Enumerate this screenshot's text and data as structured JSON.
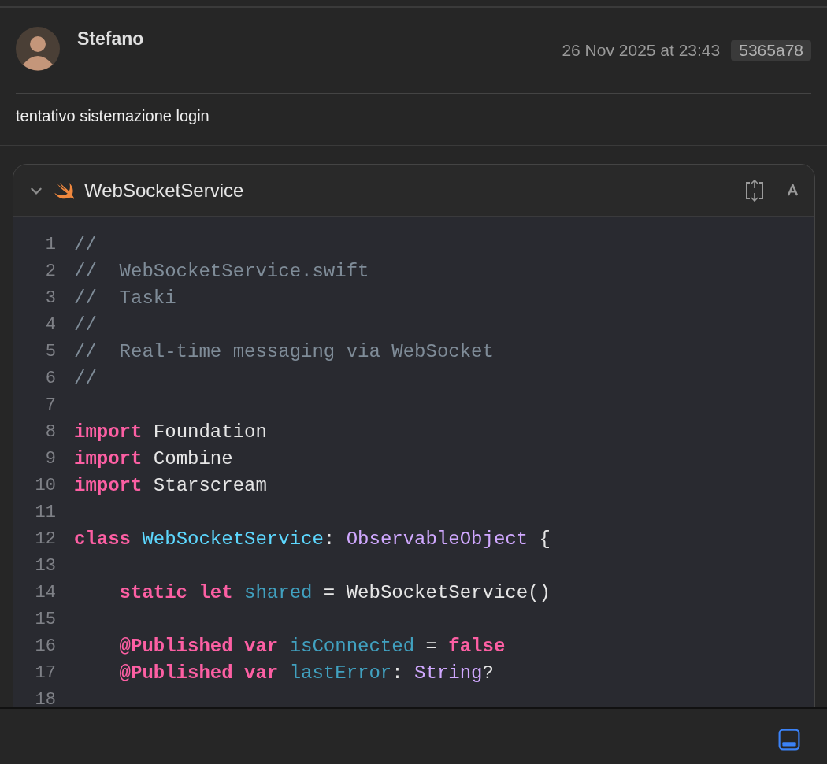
{
  "commit": {
    "author": "Stefano",
    "date": "26 Nov 2025 at 23:43",
    "hash": "5365a78",
    "message": "tentativo sistemazione login"
  },
  "file": {
    "name": "WebSocketService",
    "expanded": true,
    "lines": [
      {
        "number": "1",
        "tokens": [
          {
            "kind": "comment",
            "text": "//"
          }
        ]
      },
      {
        "number": "2",
        "tokens": [
          {
            "kind": "comment",
            "text": "//  WebSocketService.swift"
          }
        ]
      },
      {
        "number": "3",
        "tokens": [
          {
            "kind": "comment",
            "text": "//  Taski"
          }
        ]
      },
      {
        "number": "4",
        "tokens": [
          {
            "kind": "comment",
            "text": "//"
          }
        ]
      },
      {
        "number": "5",
        "tokens": [
          {
            "kind": "comment",
            "text": "//  Real-time messaging via WebSocket"
          }
        ]
      },
      {
        "number": "6",
        "tokens": [
          {
            "kind": "comment",
            "text": "//"
          }
        ]
      },
      {
        "number": "7"
      },
      {
        "number": "8",
        "tokens": [
          {
            "kind": "keyword",
            "text": "import"
          },
          {
            "kind": "plain",
            "text": " Foundation"
          }
        ]
      },
      {
        "number": "9",
        "tokens": [
          {
            "kind": "keyword",
            "text": "import"
          },
          {
            "kind": "plain",
            "text": " Combine"
          }
        ]
      },
      {
        "number": "10",
        "tokens": [
          {
            "kind": "keyword",
            "text": "import"
          },
          {
            "kind": "plain",
            "text": " Starscream"
          }
        ]
      },
      {
        "number": "11"
      },
      {
        "number": "12",
        "tokens": [
          {
            "kind": "keyword",
            "text": "class"
          },
          {
            "kind": "declaration",
            "text": " WebSocketService"
          },
          {
            "kind": "plain",
            "text": ": "
          },
          {
            "kind": "type",
            "text": "ObservableObject"
          },
          {
            "kind": "plain",
            "text": " {"
          }
        ]
      },
      {
        "number": "13"
      },
      {
        "number": "14",
        "tokens": [
          {
            "kind": "keyword",
            "text": "    static let"
          },
          {
            "kind": "property",
            "text": " shared"
          },
          {
            "kind": "plain",
            "text": " = WebSocketService()"
          }
        ]
      },
      {
        "number": "15"
      },
      {
        "number": "16",
        "tokens": [
          {
            "kind": "keyword",
            "text": "    @Published var"
          },
          {
            "kind": "property",
            "text": " isConnected"
          },
          {
            "kind": "plain",
            "text": " = "
          },
          {
            "kind": "keyword",
            "text": "false"
          }
        ]
      },
      {
        "number": "17",
        "tokens": [
          {
            "kind": "keyword",
            "text": "    @Published var"
          },
          {
            "kind": "property",
            "text": " lastError"
          },
          {
            "kind": "plain",
            "text": ": "
          },
          {
            "kind": "type",
            "text": "String"
          },
          {
            "kind": "plain",
            "text": "?"
          }
        ]
      },
      {
        "number": "18"
      }
    ]
  }
}
